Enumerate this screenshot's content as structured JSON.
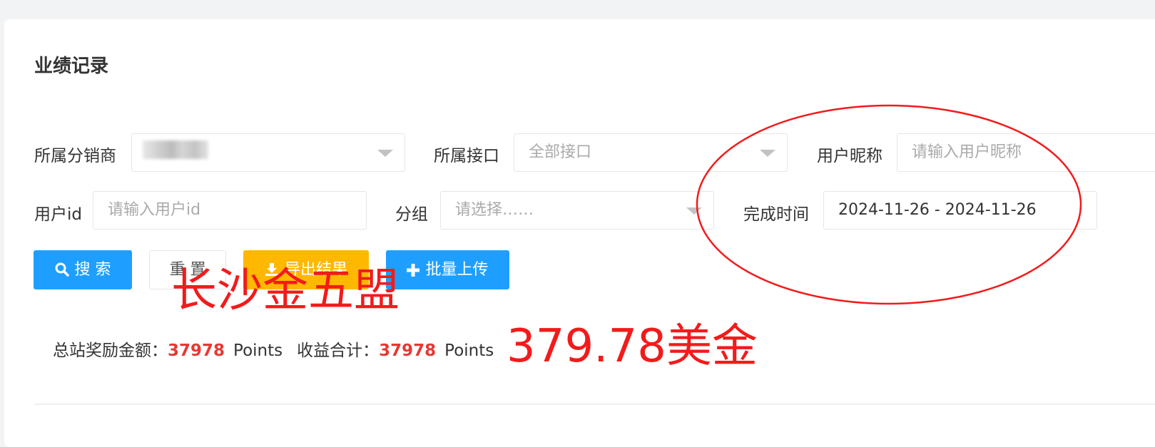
{
  "page": {
    "title": "业绩记录"
  },
  "filters": {
    "distributor_label": "所属分销商",
    "interface_label": "所属接口",
    "interface_value": "全部接口",
    "nickname_label": "用户昵称",
    "nickname_placeholder": "请输入用户昵称",
    "userid_label": "用户id",
    "userid_placeholder": "请输入用户id",
    "group_label": "分组",
    "group_placeholder": "请选择……",
    "time_label": "完成时间",
    "time_value": "2024-11-26 - 2024-11-26"
  },
  "buttons": {
    "search": "搜 索",
    "reset": "重 置",
    "export": "导出结果",
    "batch_upload": "批量上传"
  },
  "summary": {
    "reward_label": "总站奖励金额：",
    "reward_value": "37978",
    "reward_unit": "Points",
    "income_label": "收益合计：",
    "income_value": "37978",
    "income_unit": "Points"
  },
  "annotations": {
    "handwritten_1": "长沙金五盟",
    "handwritten_2": "379.78美金",
    "color": "#f21b1b"
  },
  "colors": {
    "primary": "#1e9fff",
    "warning": "#ffb800",
    "highlight_number": "#e53935"
  }
}
